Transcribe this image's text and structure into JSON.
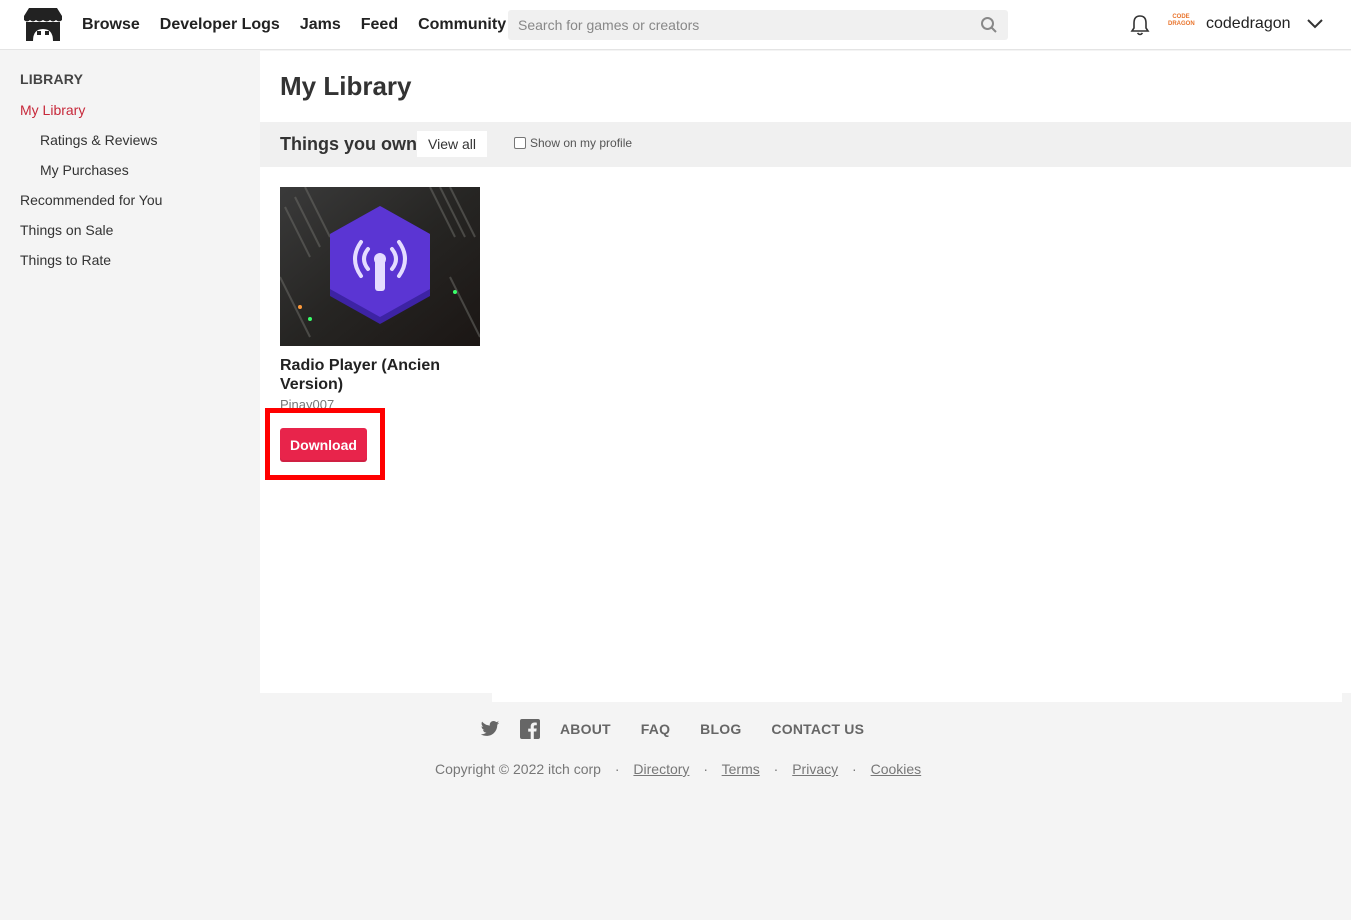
{
  "header": {
    "nav": [
      "Browse",
      "Developer Logs",
      "Jams",
      "Feed",
      "Community"
    ],
    "search_placeholder": "Search for games or creators",
    "avatar_text": "CODE DRAGON",
    "username": "codedragon"
  },
  "sidebar": {
    "heading": "LIBRARY",
    "items": [
      {
        "label": "My Library",
        "active": true
      },
      {
        "label": "Ratings & Reviews"
      },
      {
        "label": "My Purchases"
      },
      {
        "label": "Recommended for You"
      },
      {
        "label": "Things on Sale"
      },
      {
        "label": "Things to Rate"
      }
    ]
  },
  "main": {
    "title": "My Library",
    "section_title": "Things you own",
    "view_all": "View all",
    "show_on_profile": "Show on my profile",
    "games": [
      {
        "title": "Radio Player (Ancien Version)",
        "author": "Pinay007",
        "button": "Download"
      }
    ]
  },
  "footer": {
    "links": [
      "ABOUT",
      "FAQ",
      "BLOG",
      "CONTACT US"
    ],
    "copyright": "Copyright © 2022 itch corp",
    "legal": [
      "Directory",
      "Terms",
      "Privacy",
      "Cookies"
    ]
  },
  "colors": {
    "accent": "#e8244b",
    "active_link": "#c7293b",
    "highlight": "#ff0000"
  }
}
